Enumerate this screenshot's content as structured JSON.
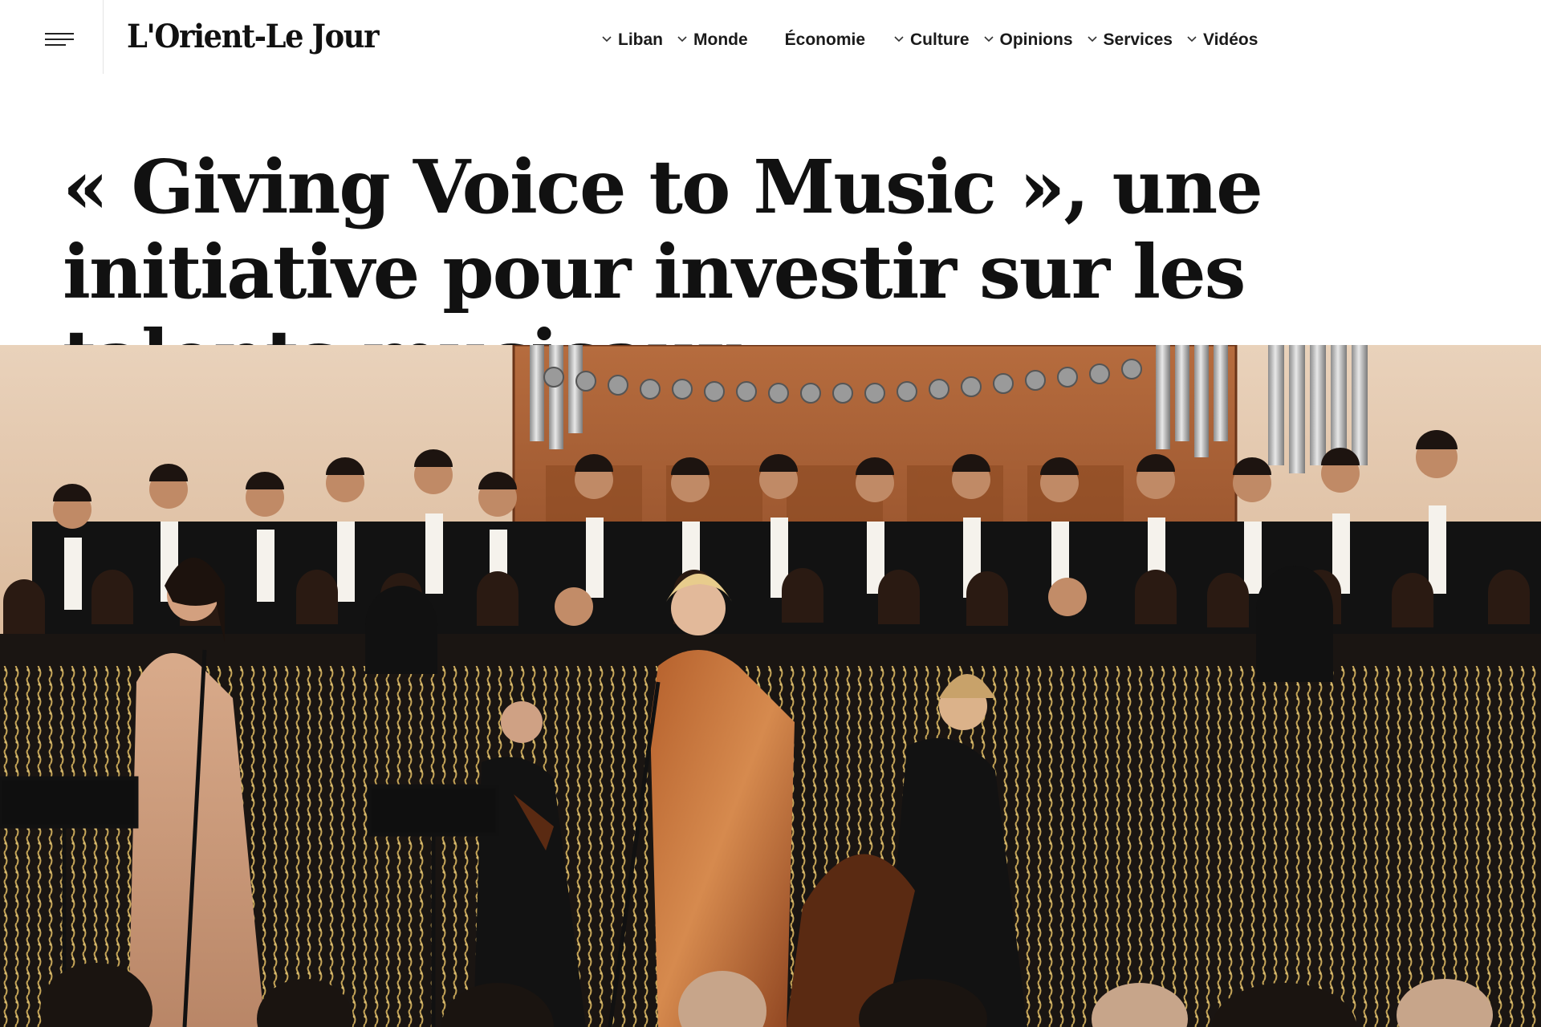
{
  "header": {
    "logo_text": "L'Orient-Le Jour",
    "menu_icon": "hamburger-menu-icon",
    "nav": [
      {
        "label": "Liban",
        "has_dropdown": true
      },
      {
        "label": "Monde",
        "has_dropdown": true
      },
      {
        "label": "Économie",
        "has_dropdown": false
      },
      {
        "label": "Culture",
        "has_dropdown": true
      },
      {
        "label": "Opinions",
        "has_dropdown": true
      },
      {
        "label": "Services",
        "has_dropdown": true
      },
      {
        "label": "Vidéos",
        "has_dropdown": true
      }
    ]
  },
  "article": {
    "headline": "« Giving Voice to Music », une initiative pour investir sur les talents musicaux"
  },
  "colors": {
    "text": "#111111",
    "background": "#ffffff",
    "divider": "#e3e3e3"
  }
}
